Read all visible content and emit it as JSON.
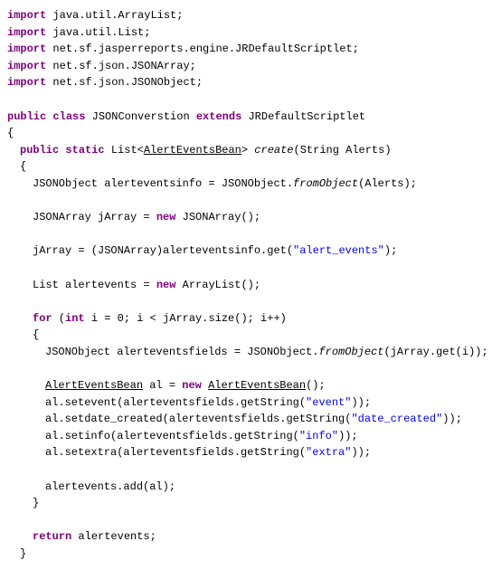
{
  "imports": [
    {
      "kw": "import",
      "pkg": " java.util.ArrayList;"
    },
    {
      "kw": "import",
      "pkg": " java.util.List;"
    },
    {
      "kw": "import",
      "pkg": " net.sf.jasperreports.engine.JRDefaultScriptlet;"
    },
    {
      "kw": "import",
      "pkg": " net.sf.json.JSONArray;"
    },
    {
      "kw": "import",
      "pkg": " net.sf.json.JSONObject;"
    }
  ],
  "classdecl": {
    "public": "public",
    "class": "class",
    "name": " JSONConverstion ",
    "extends": "extends",
    "parent": " JRDefaultScriptlet"
  },
  "methoddecl": {
    "public": "public",
    "static": "static",
    "listtype": " List<",
    "bean": "AlertEventsBean",
    "close": "> ",
    "create": "create",
    "params": "(String Alerts)"
  },
  "l1": {
    "a": "JSONObject alerteventsinfo = JSONObject.",
    "b": "fromObject",
    "c": "(Alerts);"
  },
  "l2": {
    "a": "JSONArray jArray = ",
    "new": "new",
    "b": " JSONArray();"
  },
  "l3": {
    "a": "jArray = (JSONArray)alerteventsinfo.get(",
    "str": "\"alert_events\"",
    "b": ");"
  },
  "l4": {
    "a": "List alertevents = ",
    "new": "new",
    "b": " ArrayList();"
  },
  "forloop": {
    "for": "for",
    "a": " (",
    "int": "int",
    "b": " i = 0; i < jArray.size(); i++)"
  },
  "l5": {
    "a": "JSONObject alerteventsfields = JSONObject.",
    "b": "fromObject",
    "c": "(jArray.get(i));"
  },
  "l6": {
    "bean": "AlertEventsBean",
    "a": " al = ",
    "new": "new",
    "b": " ",
    "bean2": "AlertEventsBean",
    "c": "();"
  },
  "l7": {
    "a": "al.setevent(alerteventsfields.getString(",
    "str": "\"event\"",
    "b": "));"
  },
  "l8": {
    "a": "al.setdate_created(alerteventsfields.getString(",
    "str": "\"date_created\"",
    "b": "));"
  },
  "l9": {
    "a": "al.setinfo(alerteventsfields.getString(",
    "str": "\"info\"",
    "b": "));"
  },
  "l10": {
    "a": "al.setextra(alerteventsfields.getString(",
    "str": "\"extra\"",
    "b": "));"
  },
  "l11": {
    "a": "alertevents.add(al);"
  },
  "ret": {
    "return": "return",
    "a": " alertevents;"
  },
  "brace_open": "{",
  "brace_close": "}"
}
